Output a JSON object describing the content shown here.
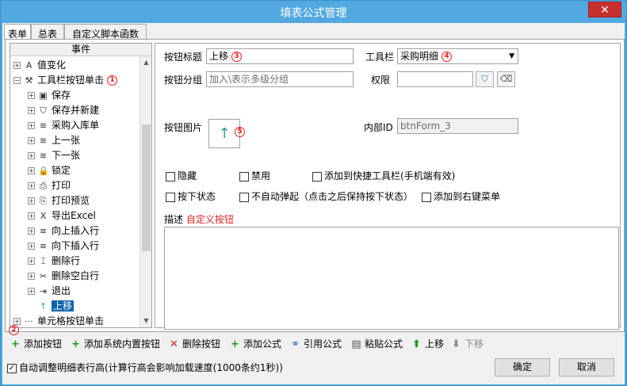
{
  "window": {
    "title": "填表公式管理",
    "close_glyph": "✕"
  },
  "tabs": [
    {
      "label": "表单"
    },
    {
      "label": "总表"
    },
    {
      "label": "自定义脚本函数"
    }
  ],
  "tree": {
    "header": "事件",
    "rows": [
      {
        "label": "值变化",
        "icon": "value-change-icon",
        "glyph": "A",
        "expander": "+"
      },
      {
        "label": "工具栏按钮单击",
        "icon": "toolbar-click-icon",
        "glyph": "⚒",
        "expander": "−",
        "marker": "1"
      },
      {
        "label": "保存",
        "icon": "save-icon",
        "glyph": "▣",
        "expander": "+"
      },
      {
        "label": "保存并新建",
        "icon": "shield-icon",
        "glyph": "⛉",
        "expander": "+"
      },
      {
        "label": "采购入库单",
        "icon": "layers-icon",
        "glyph": "≋",
        "expander": "+"
      },
      {
        "label": "上一张",
        "icon": "layers-icon",
        "glyph": "≋",
        "expander": "+"
      },
      {
        "label": "下一张",
        "icon": "layers-icon",
        "glyph": "≋",
        "expander": "+"
      },
      {
        "label": "锁定",
        "icon": "lock-icon",
        "glyph": "🔒",
        "expander": "+"
      },
      {
        "label": "打印",
        "icon": "printer-icon",
        "glyph": "⎙",
        "expander": "+"
      },
      {
        "label": "打印预览",
        "icon": "print-preview-icon",
        "glyph": "⎘",
        "expander": "+"
      },
      {
        "label": "导出Excel",
        "icon": "excel-icon",
        "glyph": "X",
        "expander": "+"
      },
      {
        "label": "向上插入行",
        "icon": "insert-row-up-icon",
        "glyph": "≡",
        "expander": "+"
      },
      {
        "label": "向下插入行",
        "icon": "insert-row-down-icon",
        "glyph": "≡",
        "expander": "+"
      },
      {
        "label": "删除行",
        "icon": "delete-row-icon",
        "glyph": "⌶",
        "expander": "+"
      },
      {
        "label": "删除空白行",
        "icon": "scissors-icon",
        "glyph": "✂",
        "expander": "+"
      },
      {
        "label": "退出",
        "icon": "exit-icon",
        "glyph": "⇥",
        "expander": "+"
      },
      {
        "label": "上移",
        "icon": "arrow-up-icon",
        "glyph": "↑",
        "expander": "",
        "selected": true
      },
      {
        "label": "单元格按钮单击",
        "icon": "dots-icon",
        "glyph": "···",
        "expander": "+"
      }
    ]
  },
  "form": {
    "button_title_label": "按钮标题",
    "button_title_value": "上移",
    "button_title_marker": "3",
    "toolbar_label": "工具栏",
    "toolbar_value": "采购明细",
    "toolbar_marker": "4",
    "group_label": "按钮分组",
    "group_placeholder": "加入\\表示多级分组",
    "permission_label": "权限",
    "image_label": "按钮图片",
    "image_marker": "5",
    "internal_id_label": "内部ID",
    "internal_id_value": "btnForm_3",
    "checkboxes": [
      {
        "label": "隐藏",
        "checked": false
      },
      {
        "label": "禁用",
        "checked": false
      },
      {
        "label": "添加到快捷工具栏(手机端有效)",
        "checked": false
      },
      {
        "label": "按下状态",
        "checked": false
      },
      {
        "label": "不自动弹起（点击之后保持按下状态）",
        "checked": false
      },
      {
        "label": "添加到右键菜单",
        "checked": false
      }
    ],
    "desc_label": "描述",
    "desc_value": "自定义按钮"
  },
  "toolbar": {
    "marker": "2",
    "items": [
      {
        "label": "添加按钮",
        "icon": "plus-icon",
        "glyph": "+",
        "color": "#1a9a1a"
      },
      {
        "label": "添加系统内置按钮",
        "icon": "plus-icon",
        "glyph": "+",
        "color": "#1a9a1a"
      },
      {
        "label": "删除按钮",
        "icon": "delete-x-icon",
        "glyph": "✕",
        "color": "#d02020"
      },
      {
        "label": "添加公式",
        "icon": "plus-icon",
        "glyph": "+",
        "color": "#1a9a1a"
      },
      {
        "label": "引用公式",
        "icon": "link-icon",
        "glyph": "⚭",
        "color": "#3a6fb8"
      },
      {
        "label": "粘贴公式",
        "icon": "paste-icon",
        "glyph": "▤",
        "color": "#555555"
      },
      {
        "label": "上移",
        "icon": "arrow-up-icon",
        "glyph": "⬆",
        "color": "#1a9a1a"
      },
      {
        "label": "下移",
        "icon": "arrow-down-icon",
        "glyph": "⬇",
        "color": "#8a8a8a",
        "disabled": true
      }
    ]
  },
  "footer": {
    "auto_height_label": "自动调整明细表行高(计算行高会影响加载速度(1000条约1秒))",
    "auto_height_checked": true,
    "ok_label": "确定",
    "cancel_label": "取消"
  },
  "colors": {
    "titlebar": "#52a9e0",
    "close": "#c7312d",
    "marker_red": "#e02020",
    "selection": "#0a64ad"
  }
}
